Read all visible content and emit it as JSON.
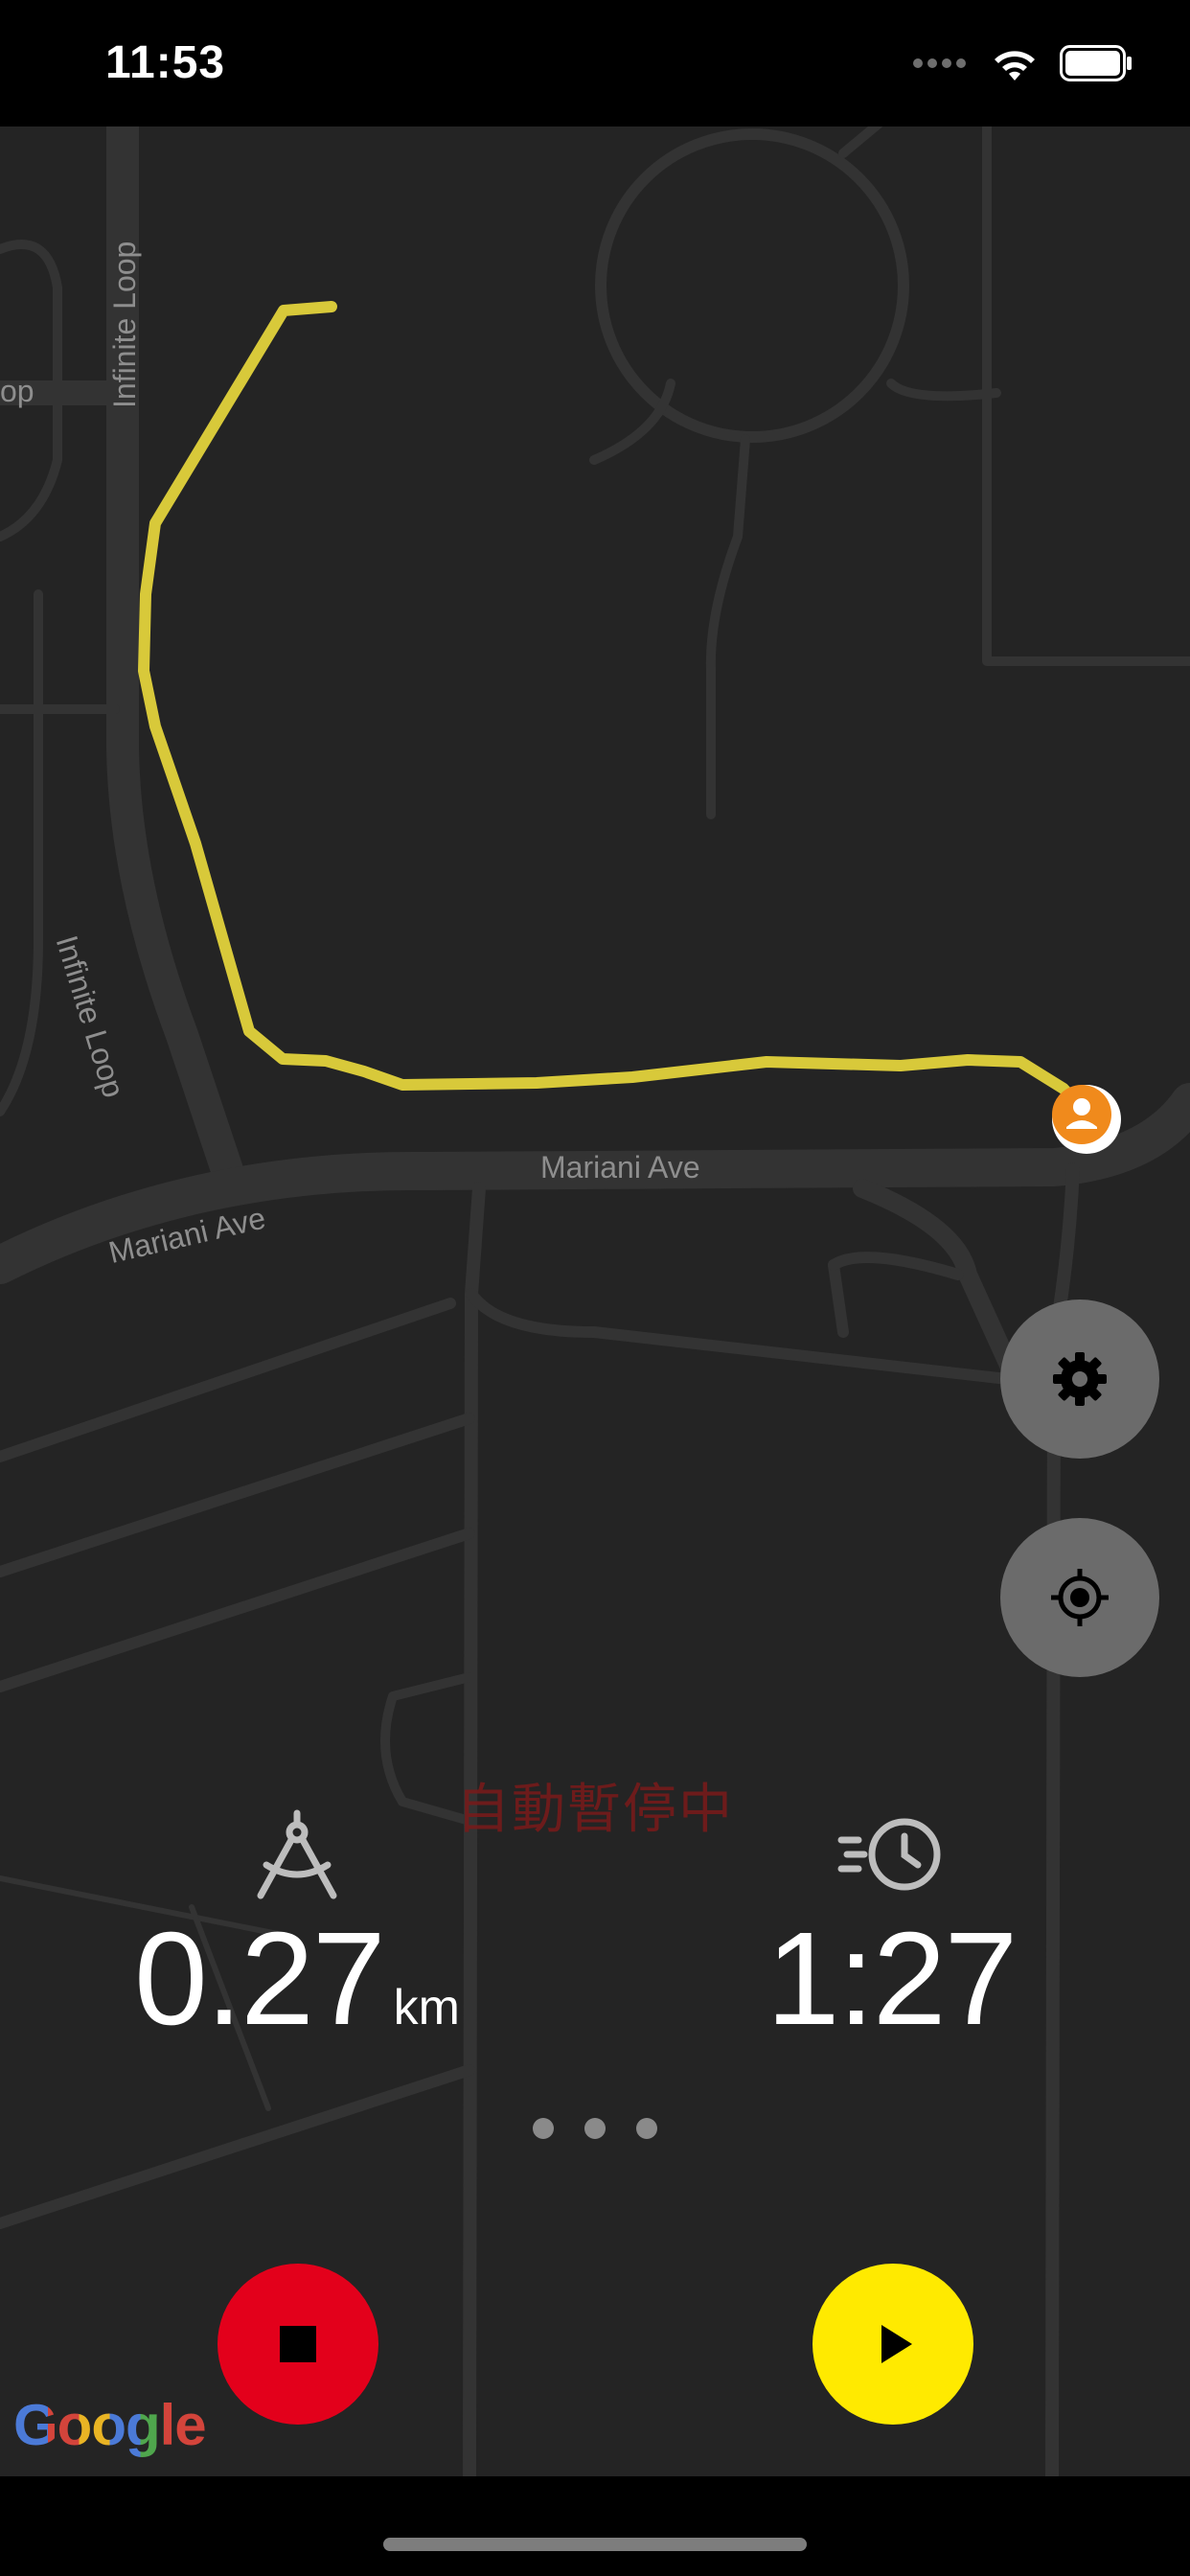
{
  "status_bar": {
    "time": "11:53",
    "signal_icon": "signal-dots-icon",
    "wifi_icon": "wifi-icon",
    "battery_icon": "battery-full-icon"
  },
  "map": {
    "labels": {
      "infinite_loop_top": "Infinite Loop",
      "infinite_loop_mid": "Infinite Loop",
      "mariani_left": "Mariani Ave",
      "mariani_center": "Mariani Ave",
      "edge_fragment": "op"
    },
    "route_color": "#d8c93a",
    "user_marker_color": "#f08a1c",
    "attribution": "Google"
  },
  "controls": {
    "settings_icon": "gear-icon",
    "locate_icon": "crosshair-icon"
  },
  "status": {
    "auto_pause": "自動暫停中"
  },
  "stats": {
    "distance": {
      "icon": "compass-divider-icon",
      "value": "0.27",
      "unit": "km"
    },
    "time": {
      "icon": "speed-clock-icon",
      "value": "1:27"
    }
  },
  "pager": {
    "pages": 3
  },
  "buttons": {
    "stop": {
      "icon": "stop-icon",
      "color": "#e3001b"
    },
    "play": {
      "icon": "play-icon",
      "color": "#ffea00"
    }
  }
}
